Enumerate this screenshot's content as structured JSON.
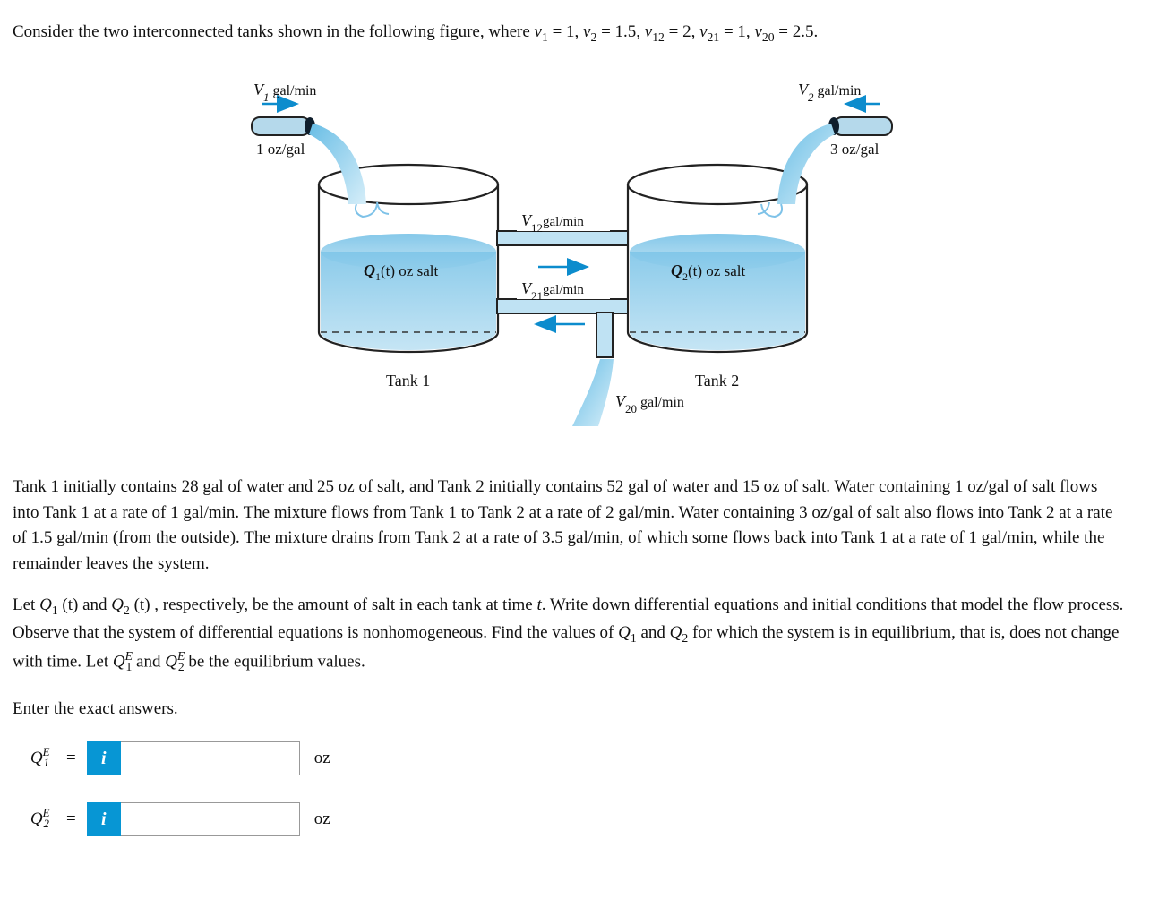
{
  "intro": {
    "prefix": "Consider the two interconnected tanks shown in the following figure, where ",
    "v1": "v",
    "v1_sub": "1",
    "v1_eq": " = 1, ",
    "v2": "v",
    "v2_sub": "2",
    "v2_eq": " = 1.5, ",
    "v12": "v",
    "v12_sub": "12",
    "v12_eq": " = 2, ",
    "v21": "v",
    "v21_sub": "21",
    "v21_eq": " = 1, ",
    "v20": "v",
    "v20_sub": "20",
    "v20_eq": " = 2.5."
  },
  "figure": {
    "v1_label": "V",
    "v1_sub": "1",
    "v1_unit": " gal/min",
    "v2_label": "V",
    "v2_sub": "2",
    "v2_unit": " gal/min",
    "conc1": "1 oz/gal",
    "conc2": "3 oz/gal",
    "q1": "Q",
    "q1_arg": "(t) oz salt",
    "q2": "Q",
    "q2_arg": "(t) oz salt",
    "q1_sub": "1",
    "q2_sub": "2",
    "v12_label": "V",
    "v12_sub": "12",
    "v12_unit": "gal/min",
    "v21_label": "V",
    "v21_sub": "21",
    "v21_unit": "gal/min",
    "v20_label": "V",
    "v20_sub": "20",
    "v20_unit": " gal/min",
    "tank1": "Tank 1",
    "tank2": "Tank 2"
  },
  "paragraph": "Tank 1 initially contains 28 gal of water and 25 oz of salt, and Tank 2 initially contains 52 gal of water and 15 oz of salt. Water containing 1 oz/gal of salt flows into Tank 1 at a rate of 1 gal/min. The mixture flows from Tank 1 to Tank 2 at a rate of 2 gal/min. Water containing 3 oz/gal of salt also flows into Tank 2 at a rate of 1.5 gal/min (from the outside). The mixture drains from Tank 2 at a rate of 3.5 gal/min, of which some flows back into Tank 1 at a rate of 1 gal/min, while the remainder leaves the system.",
  "let_para": {
    "prefix": "Let ",
    "q1": "Q",
    "q1_sub": "1",
    "q1_arg": " (t)",
    "and1": " and ",
    "q2": "Q",
    "q2_sub": "2",
    "q2_arg": " (t)",
    "mid": ", respectively, be the amount of salt in each tank at time ",
    "t": "t",
    "after_t": ". Write down differential equations and initial conditions that model the flow process. Observe that the system of differential equations is nonhomogeneous. Find the values of ",
    "qv1": "Q",
    "qv1_sub": "1",
    "and2": " and ",
    "qv2": "Q",
    "qv2_sub": "2",
    "mid2": " for which the system is in equilibrium, that is, does not change with time. Let ",
    "qe1": "Q",
    "qe1_sup": "E",
    "qe1_sub": "1",
    "and3": " and ",
    "qe2": "Q",
    "qe2_sup": "E",
    "qe2_sub": "2",
    "end": " be the equilibrium values."
  },
  "enter": "Enter the exact answers.",
  "answers": {
    "q1_sym": "Q",
    "q1_sup": "E",
    "q1_sub": "1",
    "q2_sym": "Q",
    "q2_sup": "E",
    "q2_sub": "2",
    "equals": "=",
    "info_label": "i",
    "unit": "oz",
    "value1": "",
    "value2": ""
  }
}
